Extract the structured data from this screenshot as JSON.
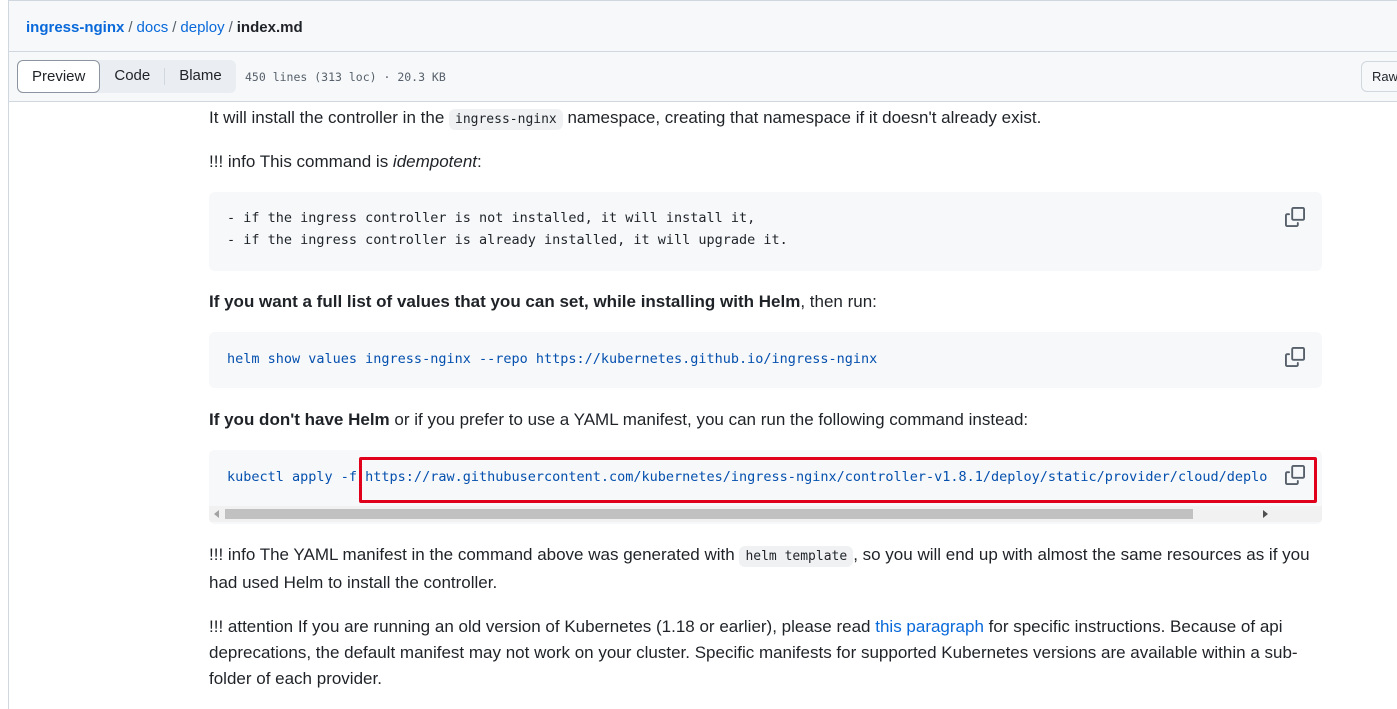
{
  "breadcrumb": {
    "repo": "ingress-nginx",
    "dir1": "docs",
    "dir2": "deploy",
    "file": "index.md",
    "separator": "/"
  },
  "toolbar": {
    "tabs": [
      {
        "label": "Preview",
        "active": true
      },
      {
        "label": "Code",
        "active": false
      },
      {
        "label": "Blame",
        "active": false
      }
    ],
    "file_meta": "450 lines (313 loc) · 20.3 KB",
    "raw_label": "Raw"
  },
  "doc": {
    "p1_before": "It will install the controller in the ",
    "p1_code": "ingress-nginx",
    "p1_after": " namespace, creating that namespace if it doesn't already exist.",
    "p2_before": "!!! info This command is ",
    "p2_em": "idempotent",
    "p2_after": ":",
    "code1_line1": "- if the ingress controller is not installed, it will install it,",
    "code1_line2": "- if the ingress controller is already installed, it will upgrade it.",
    "p3_bold1": "If you want a full list of values that you can set, while installing with Helm",
    "p3_after": ", then run:",
    "code2": "helm show values ingress-nginx --repo https://kubernetes.github.io/ingress-nginx",
    "p4_bold": "If you don't have Helm",
    "p4_after": " or if you prefer to use a YAML manifest, you can run the following command instead:",
    "code3": "kubectl apply -f https://raw.githubusercontent.com/kubernetes/ingress-nginx/controller-v1.8.1/deploy/static/provider/cloud/deplo",
    "p5_before": "!!! info The YAML manifest in the command above was generated with ",
    "p5_code": "helm template",
    "p5_after": ", so you will end up with almost the same resources as if you had used Helm to install the controller.",
    "p6_before": "!!! attention If you are running an old version of Kubernetes (1.18 or earlier), please read ",
    "p6_link": "this paragraph",
    "p6_after": " for specific instructions. Because of api deprecations, the default manifest may not work on your cluster. Specific manifests for supported Kubernetes versions are available within a sub-folder of each provider."
  },
  "colors": {
    "link": "#0969da",
    "highlight": "#e0001b",
    "code_bg": "#f6f8fa"
  },
  "icons": {
    "copy": "copy-icon"
  }
}
